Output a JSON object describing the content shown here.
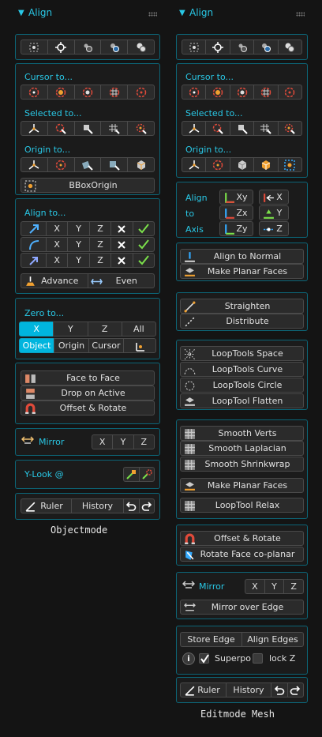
{
  "left": {
    "header": {
      "title": "Align"
    },
    "cursor_label": "Cursor to...",
    "selected_label": "Selected to...",
    "origin_label": "Origin to...",
    "bbox_label": "BBoxOrigin",
    "align_to_label": "Align to...",
    "axes": [
      "X",
      "Y",
      "Z"
    ],
    "advance_label": "Advance",
    "even_label": "Even",
    "zero_to_label": "Zero to...",
    "zero_axes": [
      "X",
      "Y",
      "Z",
      "All"
    ],
    "zero_targets": [
      "Object",
      "Origin",
      "Cursor"
    ],
    "face_to_face": "Face to Face",
    "drop_on_active": "Drop on Active",
    "offset_rotate": "Offset & Rotate",
    "mirror_label": "Mirror",
    "ylook_label": "Y-Look @",
    "ruler": "Ruler",
    "history": "History",
    "footer": "Objectmode"
  },
  "right": {
    "header": {
      "title": "Align"
    },
    "cursor_label": "Cursor to...",
    "selected_label": "Selected to...",
    "origin_label": "Origin to...",
    "align_label": "Align",
    "to_label": "to",
    "axis_label": "Axis",
    "axis_btns": [
      "Xy",
      "X",
      "Zx",
      "Y",
      "Zy",
      "Z"
    ],
    "align_to_normal": "Align to Normal",
    "make_planar_1": "Make Planar Faces",
    "straighten": "Straighten",
    "distribute": "Distribute",
    "looptools_space": "LoopTools Space",
    "looptools_curve": "LoopTools Curve",
    "looptools_circle": "LoopTools Circle",
    "looptool_flatten": "LoopTool Flatten",
    "smooth_verts": "Smooth Verts",
    "smooth_laplacian": "Smooth Laplacian",
    "smooth_shrinkwrap": "Smooth Shrinkwrap",
    "make_planar_2": "Make Planar Faces",
    "looptool_relax": "LoopTool Relax",
    "offset_rotate": "Offset & Rotate",
    "rotate_face": "Rotate Face co-planar",
    "mirror_label": "Mirror",
    "mirror_over_edge": "Mirror over Edge",
    "store_edge": "Store Edge",
    "align_edges": "Align Edges",
    "superpo": "Superpo",
    "lock_z": "lock Z",
    "ruler": "Ruler",
    "history": "History",
    "footer": "Editmode Mesh"
  },
  "colors": {
    "accent": "#29c8e6",
    "active": "#00b5de",
    "panel_border": "#0c6577",
    "check": "#7be04a"
  },
  "icons": [
    "target-icon",
    "crosshair-icon",
    "cursor-3d-icon",
    "pivot-icon",
    "multi-circle-icon",
    "arrow-icon",
    "curve-icon",
    "check-icon",
    "x-icon",
    "undo-icon",
    "redo-icon",
    "ruler-icon",
    "mirror-icon",
    "info-icon"
  ]
}
